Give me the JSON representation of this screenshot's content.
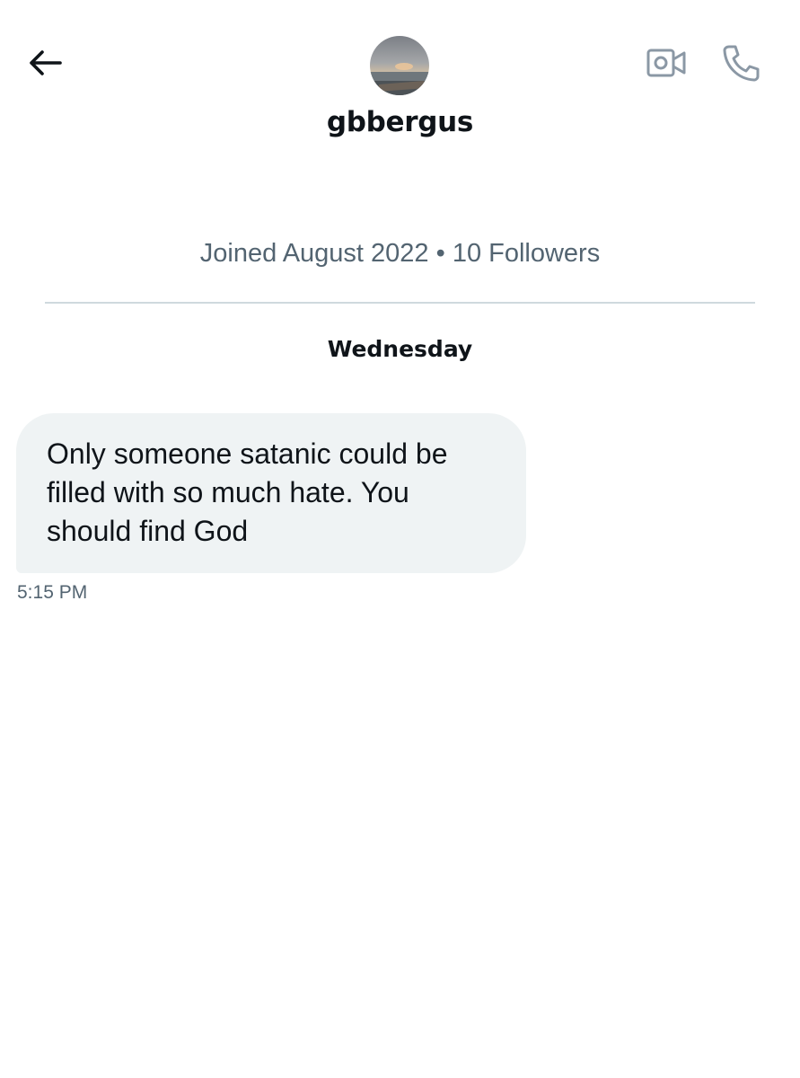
{
  "header": {
    "username": "gbbergus",
    "back_icon": "arrow-left-icon",
    "video_icon": "video-camera-icon",
    "call_icon": "phone-icon",
    "icon_color_primary": "#0f1419",
    "icon_color_secondary": "#8b98a5"
  },
  "profile": {
    "meta": "Joined August 2022 • 10 Followers"
  },
  "conversation": {
    "day_label": "Wednesday",
    "messages": [
      {
        "text": "Only someone satanic could be filled with so much hate. You should find God",
        "time": "5:15 PM"
      }
    ]
  },
  "colors": {
    "bubble_background": "#eff3f4",
    "secondary_text": "#536471",
    "divider": "#cfd9de"
  }
}
